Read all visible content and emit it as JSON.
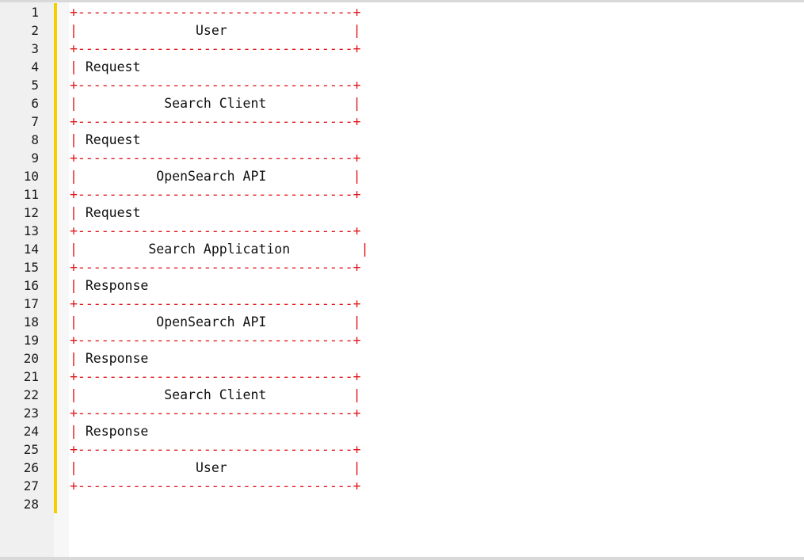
{
  "editor": {
    "lines": [
      [
        {
          "t": "+-----------------------------------+",
          "c": "red"
        }
      ],
      [
        {
          "t": "|",
          "c": "red"
        },
        {
          "t": "               User                ",
          "c": ""
        },
        {
          "t": "|",
          "c": "red"
        }
      ],
      [
        {
          "t": "+-----------------------------------+",
          "c": "red"
        }
      ],
      [
        {
          "t": "|",
          "c": "red"
        },
        {
          "t": " Request",
          "c": ""
        }
      ],
      [
        {
          "t": "+-----------------------------------+",
          "c": "red"
        }
      ],
      [
        {
          "t": "|",
          "c": "red"
        },
        {
          "t": "           Search Client           ",
          "c": ""
        },
        {
          "t": "|",
          "c": "red"
        }
      ],
      [
        {
          "t": "+-----------------------------------+",
          "c": "red"
        }
      ],
      [
        {
          "t": "|",
          "c": "red"
        },
        {
          "t": " Request",
          "c": ""
        }
      ],
      [
        {
          "t": "+-----------------------------------+",
          "c": "red"
        }
      ],
      [
        {
          "t": "|",
          "c": "red"
        },
        {
          "t": "          OpenSearch API           ",
          "c": ""
        },
        {
          "t": "|",
          "c": "red"
        }
      ],
      [
        {
          "t": "+-----------------------------------+",
          "c": "red"
        }
      ],
      [
        {
          "t": "|",
          "c": "red"
        },
        {
          "t": " Request",
          "c": ""
        }
      ],
      [
        {
          "t": "+-----------------------------------+",
          "c": "red"
        }
      ],
      [
        {
          "t": "|",
          "c": "red"
        },
        {
          "t": "         Search Application         ",
          "c": ""
        },
        {
          "t": "|",
          "c": "red"
        }
      ],
      [
        {
          "t": "+-----------------------------------+",
          "c": "red"
        }
      ],
      [
        {
          "t": "|",
          "c": "red"
        },
        {
          "t": " Response",
          "c": ""
        }
      ],
      [
        {
          "t": "+-----------------------------------+",
          "c": "red"
        }
      ],
      [
        {
          "t": "|",
          "c": "red"
        },
        {
          "t": "          OpenSearch API           ",
          "c": ""
        },
        {
          "t": "|",
          "c": "red"
        }
      ],
      [
        {
          "t": "+-----------------------------------+",
          "c": "red"
        }
      ],
      [
        {
          "t": "|",
          "c": "red"
        },
        {
          "t": " Response",
          "c": ""
        }
      ],
      [
        {
          "t": "+-----------------------------------+",
          "c": "red"
        }
      ],
      [
        {
          "t": "|",
          "c": "red"
        },
        {
          "t": "           Search Client           ",
          "c": ""
        },
        {
          "t": "|",
          "c": "red"
        }
      ],
      [
        {
          "t": "+-----------------------------------+",
          "c": "red"
        }
      ],
      [
        {
          "t": "|",
          "c": "red"
        },
        {
          "t": " Response",
          "c": ""
        }
      ],
      [
        {
          "t": "+-----------------------------------+",
          "c": "red"
        }
      ],
      [
        {
          "t": "|",
          "c": "red"
        },
        {
          "t": "               User                ",
          "c": ""
        },
        {
          "t": "|",
          "c": "red"
        }
      ],
      [
        {
          "t": "+-----------------------------------+",
          "c": "red"
        }
      ],
      []
    ]
  },
  "colors": {
    "border_chars": "#e0161a",
    "text": "#111111",
    "change_bar": "#f5d000",
    "gutter": "#f0f0f0"
  }
}
